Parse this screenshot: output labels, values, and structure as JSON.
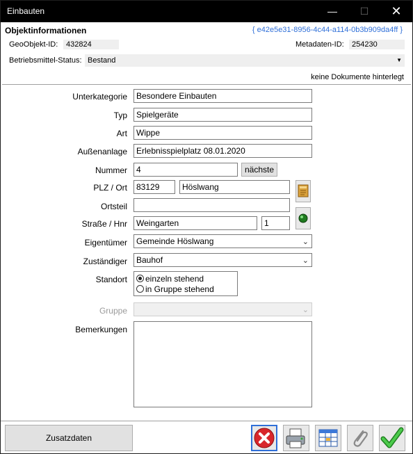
{
  "window": {
    "title": "Einbauten",
    "minimize": "—",
    "maximize": "☐",
    "close": "✕"
  },
  "header": {
    "section_title": "Objektinformationen",
    "guid": "{ e42e5e31-8956-4c44-a114-0b3b909da4ff }",
    "geoobjekt_label": "GeoObjekt-ID:",
    "geoobjekt_value": "432824",
    "metadaten_label": "Metadaten-ID:",
    "metadaten_value": "254230",
    "status_label": "Betriebsmittel-Status:",
    "status_value": "Bestand",
    "documents_note": "keine Dokumente hinterlegt"
  },
  "form": {
    "unterkategorie": {
      "label": "Unterkategorie",
      "value": "Besondere Einbauten"
    },
    "typ": {
      "label": "Typ",
      "value": "Spielgeräte"
    },
    "art": {
      "label": "Art",
      "value": "Wippe"
    },
    "aussenanlage": {
      "label": "Außenanlage",
      "value": "Erlebnisspielplatz 08.01.2020"
    },
    "nummer": {
      "label": "Nummer",
      "value": "4",
      "next_button": "nächste"
    },
    "plz_ort": {
      "label": "PLZ / Ort",
      "plz": "83129",
      "ort": "Höslwang"
    },
    "ortsteil": {
      "label": "Ortsteil",
      "value": ""
    },
    "strasse": {
      "label": "Straße / Hnr",
      "street": "Weingarten",
      "number": "1"
    },
    "eigentuemer": {
      "label": "Eigentümer",
      "value": "Gemeinde Höslwang"
    },
    "zustaendiger": {
      "label": "Zuständiger",
      "value": "Bauhof"
    },
    "standort": {
      "label": "Standort",
      "options": [
        "einzeln stehend",
        "in Gruppe stehend"
      ],
      "selected": "einzeln stehend"
    },
    "gruppe": {
      "label": "Gruppe",
      "value": ""
    },
    "bemerkungen": {
      "label": "Bemerkungen",
      "value": ""
    }
  },
  "footer": {
    "zusatzdaten": "Zusatzdaten"
  },
  "colors": {
    "titlebar": "#000000",
    "guid": "#2f6fd8",
    "focus": "#2f6fd8",
    "delete_red": "#d8262b",
    "ok_green": "#2ea12e"
  }
}
